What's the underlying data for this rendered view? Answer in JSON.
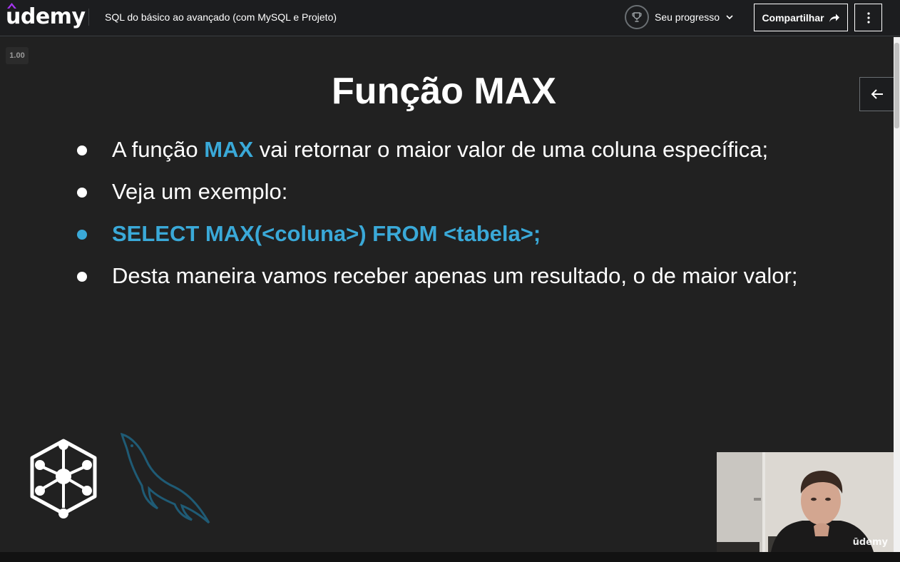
{
  "header": {
    "logo_text": "udemy",
    "course_title": "SQL do básico ao avançado (com MySQL e Projeto)",
    "progress_label": "Seu progresso",
    "share_label": "Compartilhar"
  },
  "player": {
    "speed": "1.00",
    "slide": {
      "title": "Função MAX",
      "bullets": [
        {
          "before": "A função ",
          "highlight": "MAX",
          "after": " vai retornar o maior valor de uma coluna específica;"
        },
        {
          "text": "Veja um exemplo:"
        },
        {
          "text": "SELECT MAX(<coluna>) FROM <tabela>;"
        },
        {
          "text": "Desta maneira vamos receber apenas um resultado, o de maior valor;"
        }
      ]
    },
    "webcam_watermark": "ūdemy"
  },
  "colors": {
    "accent_blue": "#3aa9d8",
    "header_bg": "#1c1d1f",
    "slide_bg": "#212121",
    "udemy_purple": "#a435f0"
  },
  "icons": {
    "trophy": "trophy-icon",
    "chevron": "chevron-down-icon",
    "share": "share-arrow-icon",
    "more": "vertical-dots-icon",
    "back": "arrow-left-icon"
  }
}
